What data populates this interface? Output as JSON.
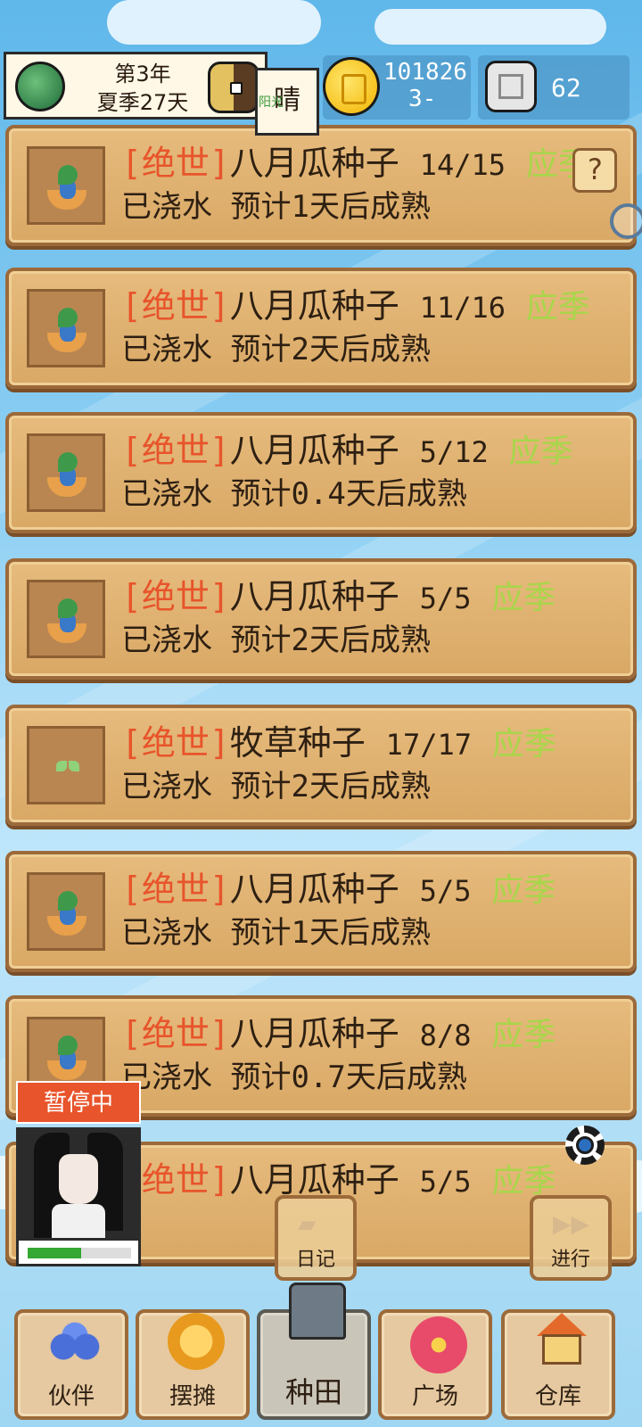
{
  "hud": {
    "date_line1": "第3年",
    "date_line2": "夏季27天",
    "weather": "晴",
    "weather_tag": "阳光",
    "coins": "101826",
    "coins_sub": "3-",
    "gems": "62"
  },
  "plots": [
    {
      "rarity": "[绝世]",
      "name": "八月瓜种子",
      "count": "14/15",
      "season": "应季",
      "status": "已浇水 预计1天后成熟",
      "icon": "blue-seed-sprout-icon"
    },
    {
      "rarity": "[绝世]",
      "name": "八月瓜种子",
      "count": "11/16",
      "season": "应季",
      "status": "已浇水 预计2天后成熟",
      "icon": "blue-seed-sprout-icon"
    },
    {
      "rarity": "[绝世]",
      "name": "八月瓜种子",
      "count": "5/12",
      "season": "应季",
      "status": "已浇水 预计0.4天后成熟",
      "icon": "blue-seed-sprout-icon"
    },
    {
      "rarity": "[绝世]",
      "name": "八月瓜种子",
      "count": "5/5",
      "season": "应季",
      "status": "已浇水 预计2天后成熟",
      "icon": "blue-seed-sprout-icon"
    },
    {
      "rarity": "[绝世]",
      "name": "牧草种子",
      "count": "17/17",
      "season": "应季",
      "status": "已浇水 预计2天后成熟",
      "icon": "grass-sprout-icon"
    },
    {
      "rarity": "[绝世]",
      "name": "八月瓜种子",
      "count": "5/5",
      "season": "应季",
      "status": "已浇水 预计1天后成熟",
      "icon": "blue-seed-sprout-icon"
    },
    {
      "rarity": "[绝世]",
      "name": "八月瓜种子",
      "count": "8/8",
      "season": "应季",
      "status": "已浇水 预计0.7天后成熟",
      "icon": "blue-seed-sprout-icon"
    },
    {
      "rarity": "[绝世]",
      "name": "八月瓜种子",
      "count": "5/5",
      "season": "应季",
      "status": "",
      "icon": "blue-seed-sprout-icon"
    }
  ],
  "overlay": {
    "help": "?",
    "pause_label": "暂停中",
    "stamina_fraction": 0.52,
    "diary_label": "日记",
    "proceed_label": "进行"
  },
  "nav": {
    "partners": "伙伴",
    "stall": "摆摊",
    "farming": "种田",
    "plaza": "广场",
    "warehouse": "仓库",
    "active": "种田"
  },
  "colors": {
    "rarity": "#e8542b",
    "season": "#a8d64a",
    "text": "#2d1f12",
    "pause": "#e8542b"
  }
}
